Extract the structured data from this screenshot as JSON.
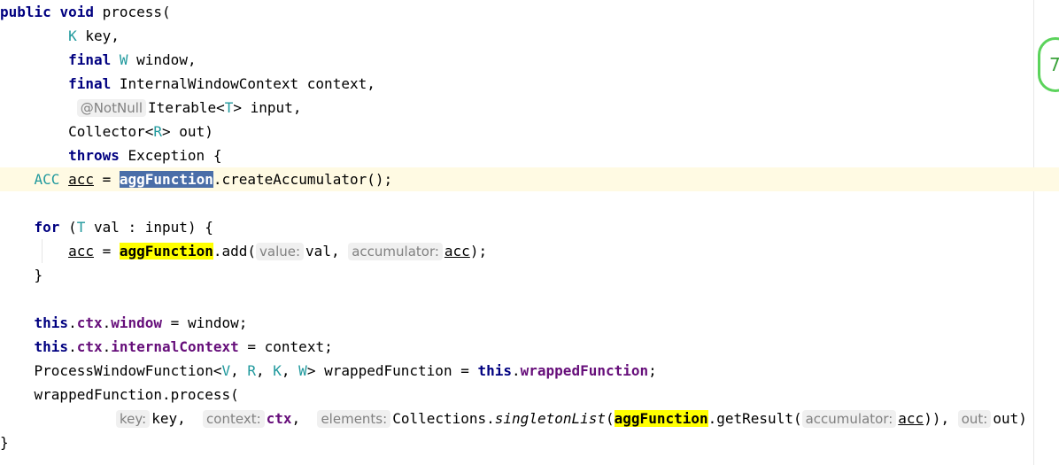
{
  "code": {
    "l1": {
      "kw1": "public",
      "kw2": "void",
      "name": "process("
    },
    "l2": {
      "type": "K",
      "rest": " key,"
    },
    "l3": {
      "kw": "final",
      "type": "W",
      "rest": " window,"
    },
    "l4": {
      "kw": "final",
      "rest": " InternalWindowContext context,"
    },
    "l5": {
      "annotation": "@NotNull",
      "a": "Iterable<",
      "type": "T",
      "b": "> input,"
    },
    "l6": {
      "a": "Collector<",
      "type": "R",
      "b": "> out)"
    },
    "l7": {
      "kw": "throws",
      "rest": " Exception {"
    },
    "l8": {
      "type": "ACC",
      "var": "acc",
      "eq": " = ",
      "sel": "aggFunction",
      "rest": ".createAccumulator();"
    },
    "l10": {
      "kw": "for",
      "a": " (",
      "type": "T",
      "b": " val : input) {"
    },
    "l11": {
      "var": "acc",
      "eq": " = ",
      "hl": "aggFunction",
      "a": ".add(",
      "hint1": "value:",
      "b": "val, ",
      "hint2": "accumulator:",
      "var2": "acc",
      "c": ");"
    },
    "l12": {
      "brace": "}"
    },
    "l14": {
      "kw": "this",
      "dot1": ".",
      "f1": "ctx",
      "dot2": ".",
      "f2": "window",
      "rest": " = window;"
    },
    "l15": {
      "kw": "this",
      "dot1": ".",
      "f1": "ctx",
      "dot2": ".",
      "f2": "internalContext",
      "rest": " = context;"
    },
    "l16": {
      "a": "ProcessWindowFunction<",
      "t1": "V",
      "s1": ", ",
      "t2": "R",
      "s2": ", ",
      "t3": "K",
      "s3": ", ",
      "t4": "W",
      "b": "> wrappedFunction = ",
      "kw": "this",
      "dot": ".",
      "f": "wrappedFunction",
      "c": ";"
    },
    "l17": {
      "text": "wrappedFunction.process("
    },
    "l18": {
      "hint1": "key:",
      "a": "key, ",
      "hint2": "context:",
      "f": "ctx",
      "b": ", ",
      "hint3": "elements:",
      "c": "Collections.",
      "it": "singletonList",
      "d": "(",
      "hl": "aggFunction",
      "e": ".getResult(",
      "hint4": "accumulator:",
      "var": "acc",
      "g": ")), ",
      "hint5": "out:",
      "h": "out)"
    },
    "l19": {
      "brace": "}"
    }
  },
  "status_widget": {
    "glyph": "7"
  },
  "colors": {
    "keyword": "#000080",
    "type_param": "#20999d",
    "field": "#660e7a",
    "highlight": "#ffff00",
    "selection": "#4a6ea8",
    "current_line": "#fffae3"
  }
}
